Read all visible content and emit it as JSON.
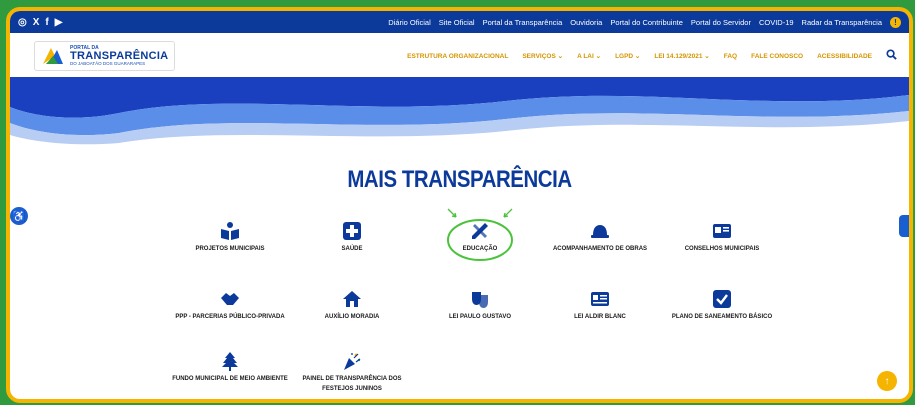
{
  "topbar": {
    "social": [
      "◎",
      "X",
      "f",
      "▶"
    ],
    "links": [
      "Diário Oficial",
      "Site Oficial",
      "Portal da Transparência",
      "Ouvidoria",
      "Portal do Contribuinte",
      "Portal do Servidor",
      "COVID-19",
      "Radar da Transparência"
    ]
  },
  "logo": {
    "small": "PORTAL DA",
    "big": "TRANSPARÊNCIA",
    "sub": "DO JABOATÃO DOS GUARARAPES"
  },
  "menu": [
    "ESTRUTURA ORGANIZACIONAL",
    "SERVIÇOS ⌄",
    "A LAI ⌄",
    "LGPD ⌄",
    "LEI 14.129/2021 ⌄",
    "FAQ",
    "FALE CONOSCO",
    "ACESSIBILIDADE"
  ],
  "title": "MAIS TRANSPARÊNCIA",
  "items": [
    {
      "label": "PROJETOS MUNICIPAIS",
      "icon": "book-reader-icon"
    },
    {
      "label": "SAÚDE",
      "icon": "medical-cross-icon"
    },
    {
      "label": "EDUCAÇÃO",
      "icon": "pencil-ruler-icon"
    },
    {
      "label": "ACOMPANHAMENTO DE OBRAS",
      "icon": "hard-hat-icon"
    },
    {
      "label": "CONSELHOS MUNICIPAIS",
      "icon": "id-card-icon"
    },
    {
      "label": "PPP - PARCERIAS PÚBLICO-PRIVADA",
      "icon": "handshake-icon"
    },
    {
      "label": "AUXÍLIO MORADIA",
      "icon": "house-icon"
    },
    {
      "label": "LEI PAULO GUSTAVO",
      "icon": "theater-masks-icon"
    },
    {
      "label": "LEI ALDIR BLANC",
      "icon": "newspaper-icon"
    },
    {
      "label": "PLANO DE SANEAMENTO BÁSICO",
      "icon": "checkbox-icon"
    },
    {
      "label": "FUNDO MUNICIPAL DE MEIO AMBIENTE",
      "icon": "tree-icon"
    },
    {
      "label": "PAINEL DE TRANSPARÊNCIA DOS FESTEJOS JUNINOS",
      "icon": "party-popper-icon"
    }
  ],
  "colors": {
    "brand": "#0b3a9a",
    "accent": "#f4b400",
    "highlight": "#4ac23a"
  }
}
